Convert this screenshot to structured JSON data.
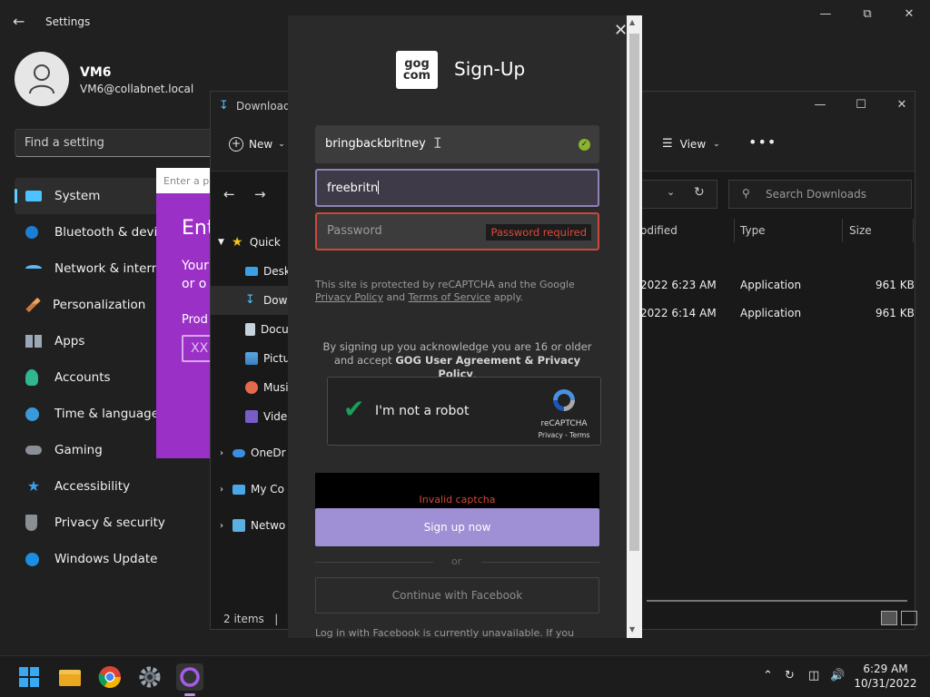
{
  "settings": {
    "title": "Settings",
    "user_name": "VM6",
    "user_email": "VM6@collabnet.local",
    "search_placeholder": "Find a setting",
    "nav": [
      {
        "label": "System",
        "icon": "monitor-icon"
      },
      {
        "label": "Bluetooth & devic",
        "icon": "bluetooth-icon"
      },
      {
        "label": "Network & interne",
        "icon": "wifi-icon"
      },
      {
        "label": "Personalization",
        "icon": "brush-icon"
      },
      {
        "label": "Apps",
        "icon": "apps-icon"
      },
      {
        "label": "Accounts",
        "icon": "person-icon"
      },
      {
        "label": "Time & language",
        "icon": "clock-globe-icon"
      },
      {
        "label": "Gaming",
        "icon": "gamepad-icon"
      },
      {
        "label": "Accessibility",
        "icon": "accessibility-icon"
      },
      {
        "label": "Privacy & security",
        "icon": "shield-icon"
      },
      {
        "label": "Windows Update",
        "icon": "update-icon"
      }
    ]
  },
  "product_dialog": {
    "input_placeholder": "Enter a pro",
    "heading": "Ent",
    "body_line1": "Your",
    "body_line2": "or o",
    "product_label": "Prod",
    "product_input": "XX"
  },
  "explorer": {
    "title": "Downloads",
    "new_label": "New",
    "view_label": "View",
    "more_label": "•••",
    "search_placeholder": "Search Downloads",
    "tree": [
      {
        "label": "Quick",
        "icon": "star-icon"
      },
      {
        "label": "Deskt",
        "icon": "desktop-icon"
      },
      {
        "label": "Down",
        "icon": "download-icon"
      },
      {
        "label": "Docu",
        "icon": "document-icon"
      },
      {
        "label": "Pictu",
        "icon": "pictures-icon"
      },
      {
        "label": "Musi",
        "icon": "music-icon"
      },
      {
        "label": "Video",
        "icon": "video-icon"
      },
      {
        "label": "OneDr",
        "icon": "onedrive-icon"
      },
      {
        "label": "My Co",
        "icon": "computer-icon"
      },
      {
        "label": "Netwo",
        "icon": "network-icon"
      }
    ],
    "columns": {
      "modified": "odified",
      "type": "Type",
      "size": "Size"
    },
    "rows": [
      {
        "modified": "2022 6:23 AM",
        "type": "Application",
        "size": "961 KB"
      },
      {
        "modified": "2022 6:14 AM",
        "type": "Application",
        "size": "961 KB"
      }
    ],
    "status": "2 items"
  },
  "gog": {
    "logo_line1": "gog",
    "logo_line2": "com",
    "heading": "Sign-Up",
    "username_value": "bringbackbritney",
    "email_value": "freebritn",
    "password_placeholder": "Password",
    "password_error": "Password required",
    "legal_text_prefix": "This site is protected by reCAPTCHA and the Google ",
    "legal_privacy": "Privacy Policy",
    "legal_and": " and ",
    "legal_terms": "Terms of Service",
    "legal_suffix": " apply.",
    "consent_prefix": "By signing up you acknowledge you are 16 or older and accept ",
    "consent_link": "GOG User Agreement & Privacy Policy",
    "consent_suffix": ".",
    "captcha_label": "I'm not a robot",
    "captcha_brand": "reCAPTCHA",
    "captcha_links": "Privacy - Terms",
    "captcha_error": "Invalid captcha",
    "signup_button": "Sign up now",
    "or_text": "or",
    "facebook_button": "Continue with Facebook",
    "facebook_note": "Log in with Facebook is currently unavailable. If you",
    "accent_color": "#9f8fd4",
    "error_color": "#e0483a",
    "success_color": "#8ab32e"
  },
  "taskbar": {
    "time": "6:29 AM",
    "date": "10/31/2022",
    "apps": [
      "windows-start-icon",
      "file-explorer-icon",
      "chrome-icon",
      "settings-icon",
      "gog-galaxy-icon"
    ]
  }
}
